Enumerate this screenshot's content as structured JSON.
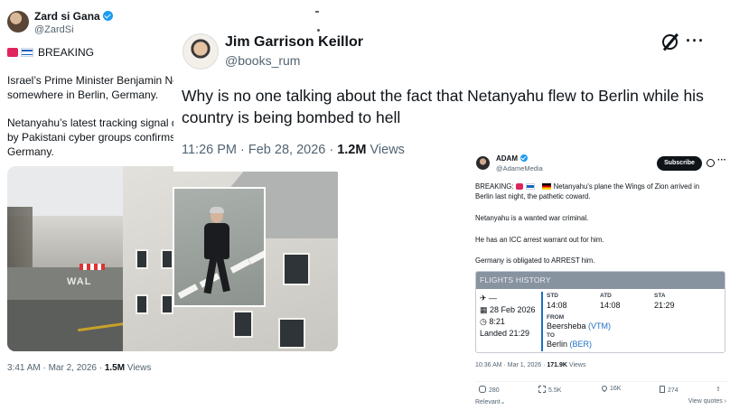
{
  "left_tweet": {
    "name": "Zard si Gana",
    "handle": "@ZardSi",
    "breaking": "BREAKING",
    "para1_line1": "Israel’s Prime Minister Benjamin Neta",
    "para1_line2": "somewhere in Berlin, Germany.",
    "para2_line1": "Netanyahu’s latest tracking signal da",
    "para2_line2": "by Pakistani cyber groups confirms t",
    "para2_line3": "Germany.",
    "media_graffiti": "WAL",
    "time": "3:41 AM · Mar 2, 2026 · ",
    "views_count": "1.5M",
    "views_label": " Views"
  },
  "middle_tweet": {
    "name": "Jim Garrison Keillor",
    "handle": "@books_rum",
    "text": "Why is no one talking about the fact that Netanyahu flew to Berlin while his country is being bombed to hell",
    "time": "11:26 PM · Feb 28, 2026 · ",
    "views_count": "1.2M",
    "views_label": " Views"
  },
  "right_tweet": {
    "name": "ADAM",
    "handle": "@AdameMedia",
    "subscribe": "Subscribe",
    "line1_prefix": "BREAKING:",
    "line1_rest": "Netanyahu's plane the Wings of Zion arrived in",
    "line1_cont": "Berlin last night, the pathetic coward.",
    "line2": "Netanyahu is a wanted war criminal.",
    "line3": "He has an ICC arrest warrant out for him.",
    "line4": "Germany is obligated to ARREST him.",
    "flights": {
      "header": "FLIGHTS HISTORY",
      "plane_row": "✈ —",
      "date": "28 Feb 2026",
      "time": "8:21",
      "status": "Landed 21:29",
      "std_label": "STD",
      "std_value": "14:08",
      "atd_label": "ATD",
      "atd_value": "14:08",
      "sta_label": "STA",
      "sta_value": "21:29",
      "from_label": "FROM",
      "from_city": "Beersheba ",
      "from_code": "(VTM)",
      "to_label": "TO",
      "to_city": "Berlin ",
      "to_code": "(BER)"
    },
    "time": "10:36 AM · Mar 1, 2026 · ",
    "views_count": "171.9K",
    "views_label": " Views",
    "replies": "280",
    "reposts": "5.5K",
    "likes": "16K",
    "bookmarks": "274",
    "relevant": "Relevant",
    "view_quotes": "View quotes"
  },
  "colors": {
    "verified": "#1d9bf0",
    "text": "#0f1419",
    "muted": "#536471",
    "flights_header": "#8893a0",
    "airport_code": "#1d6fc4"
  }
}
